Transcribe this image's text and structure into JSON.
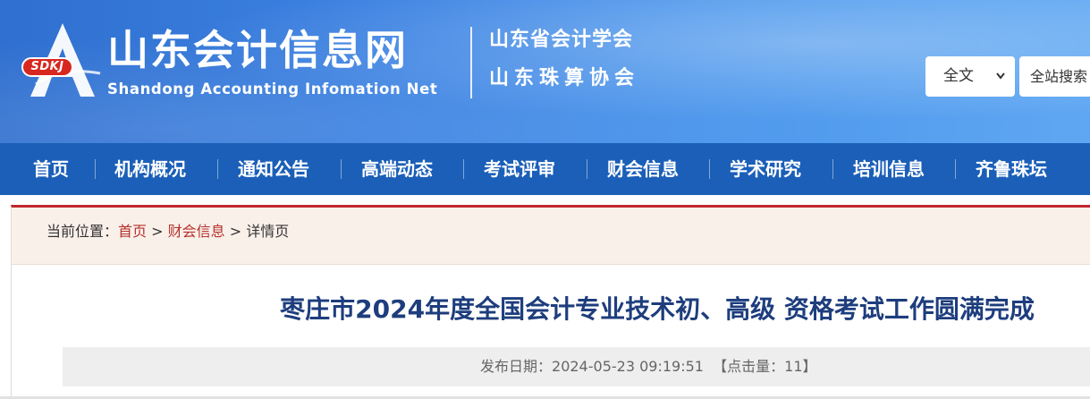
{
  "header": {
    "logo_badge": "SDKJ",
    "site_title": "山东会计信息网",
    "site_subtitle": "Shandong Accounting Infomation Net",
    "orgs": [
      "山东省会计学会",
      "山东珠算协会"
    ],
    "search": {
      "scope_selected": "全文",
      "input_placeholder": "全站搜索"
    }
  },
  "nav": {
    "items": [
      "首页",
      "机构概况",
      "通知公告",
      "高端动态",
      "考试评审",
      "财会信息",
      "学术研究",
      "培训信息",
      "齐鲁珠坛"
    ]
  },
  "breadcrumb": {
    "prefix": "当前位置：",
    "home": "首页",
    "sep1": " > ",
    "category": "财会信息",
    "sep2": " > ",
    "current": "详情页"
  },
  "article": {
    "title": "枣庄市2024年度全国会计专业技术初、高级 资格考试工作圆满完成",
    "publish_label": "发布日期：",
    "publish_date": "2024-05-23 09:19:51",
    "clicks_label": "【点击量：",
    "clicks": "11",
    "clicks_close": "】"
  },
  "colors": {
    "header_blue": "#3c82e2",
    "nav_blue": "#1b5fb8",
    "accent_red": "#c1272d",
    "title_navy": "#1d3d7d"
  }
}
